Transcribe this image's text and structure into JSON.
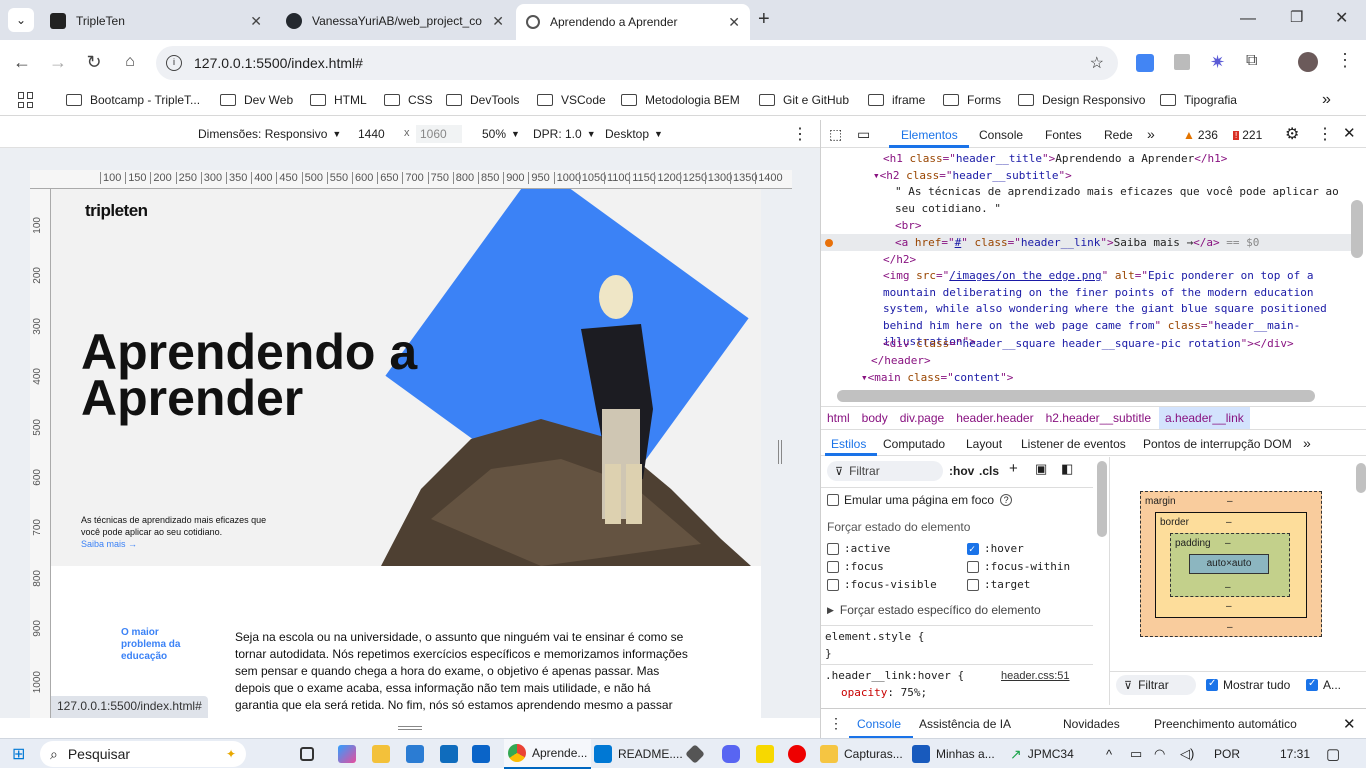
{
  "tabs": [
    {
      "title": "TripleTen",
      "icon": "tripleten-icon"
    },
    {
      "title": "VanessaYuriAB/web_project_co",
      "icon": "github-icon"
    },
    {
      "title": "Aprendendo a Aprender",
      "icon": "globe-icon"
    }
  ],
  "toolbar": {
    "url": "127.0.0.1:5500/index.html#"
  },
  "bookmarks": [
    "Bootcamp - TripleT...",
    "Dev Web",
    "HTML",
    "CSS",
    "DevTools",
    "VSCode",
    "Metodologia BEM",
    "Git e GitHub",
    "iframe",
    "Forms",
    "Design Responsivo",
    "Tipografia"
  ],
  "device": {
    "dimensions": "Dimensões: Responsivo",
    "width": "1440",
    "height": "1060",
    "sep": "x",
    "zoom": "50%",
    "dpr": "DPR: 1.0",
    "mode": "Desktop"
  },
  "ruler": [
    "100",
    "150",
    "200",
    "250",
    "300",
    "350",
    "400",
    "450",
    "500",
    "550",
    "600",
    "650",
    "700",
    "750",
    "800",
    "850",
    "900",
    "950",
    "1000",
    "1050",
    "1100",
    "1150",
    "1200",
    "1250",
    "1300",
    "1350",
    "1400"
  ],
  "vruler": [
    "100",
    "200",
    "300",
    "400",
    "500",
    "600",
    "700",
    "800",
    "900",
    "1000"
  ],
  "site": {
    "logo": "tripleten",
    "title": "Aprendendo a Aprender",
    "subtitle": "As técnicas de aprendizado mais eficazes que você pode aplicar ao seu cotidiano.",
    "link": "Saiba mais →",
    "section_title": "O maior problema da educação",
    "section_text": "Seja na escola ou na universidade, o assunto que ninguém vai te ensinar é como se tornar autodidata. Nós repetimos exercícios específicos e memorizamos informações sem pensar e quando chega a hora do exame, o objetivo é apenas passar. Mas depois que o exame acaba, essa informação não tem mais utilidade, e não há garantia que ela será retida. No fim, nós só estamos aprendendo mesmo a passar",
    "status_url": "127.0.0.1:5500/index.html#",
    "accent": "#3b82f6"
  },
  "devtools": {
    "tabs": [
      "Elementos",
      "Console",
      "Fontes",
      "Rede"
    ],
    "warnings": "236",
    "errors": "221",
    "breadcrumbs": [
      "html",
      "body",
      "div.page",
      "header.header",
      "h2.header__subtitle",
      "a.header__link"
    ],
    "style_tabs": [
      "Estilos",
      "Computado",
      "Layout",
      "Listener de eventos",
      "Pontos de interrupção DOM"
    ],
    "filter_placeholder": "Filtrar",
    "hov": ":hov",
    "cls": ".cls",
    "emulate_focus": "Emular uma página em foco",
    "force_state": "Forçar estado do elemento",
    "states": [
      ":active",
      ":hover",
      ":focus",
      ":focus-within",
      ":focus-visible",
      ":target"
    ],
    "force_specific": "Forçar estado específico do elemento",
    "element_style": "element.style {",
    "close_brace": "}",
    "rule_selector": ".header__link:hover {",
    "rule_source": "header.css:51",
    "rule_prop": "opacity",
    "rule_val": "75%;",
    "box": {
      "margin": "margin",
      "border": "border",
      "padding": "padding",
      "content": "auto×auto",
      "dash": "–"
    },
    "computed_filter": "Filtrar",
    "show_all": "Mostrar tudo",
    "a_label": "A...",
    "drawer_tabs": [
      "Console",
      "Assistência de IA",
      "Novidades",
      "Preenchimento automático"
    ]
  },
  "taskbar": {
    "search": "Pesquisar",
    "apps": [
      "Aprende...",
      "README....",
      "Capturas...",
      "Minhas a..."
    ],
    "stock": "JPMC34",
    "lang": "POR",
    "time": "17:31"
  }
}
